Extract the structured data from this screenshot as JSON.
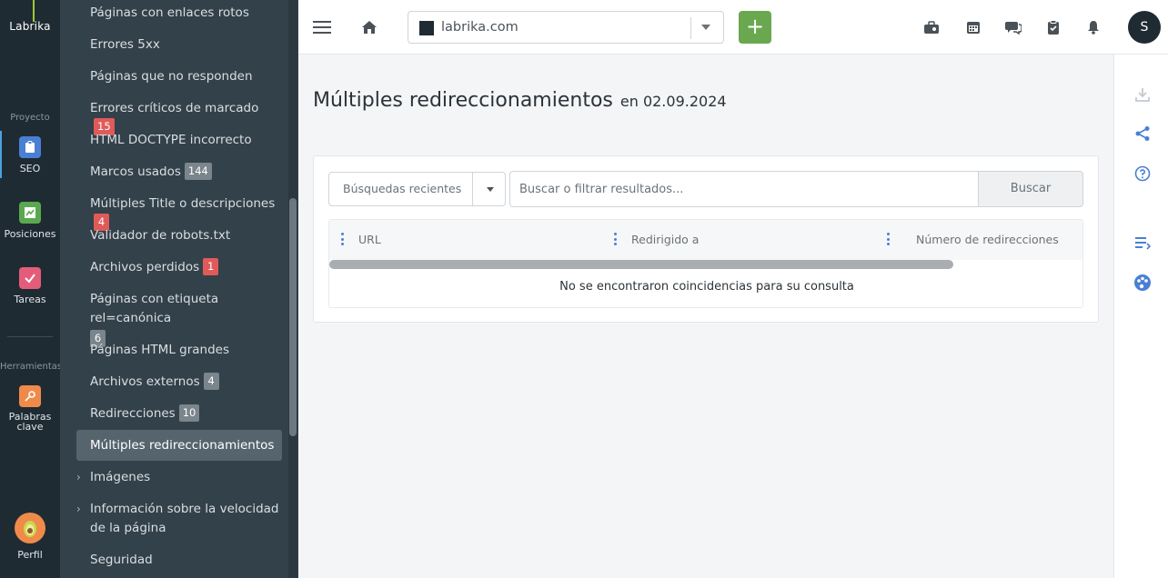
{
  "rail": {
    "logo": "Labrika",
    "section_project": "Proyecto",
    "section_tools": "Herramientas",
    "items": [
      {
        "label": "SEO",
        "icon": "clipboard-icon",
        "color": "#4a7fd4"
      },
      {
        "label": "Posiciones",
        "icon": "chart-icon",
        "color": "#5aa84f"
      },
      {
        "label": "Tareas",
        "icon": "check-icon",
        "color": "#e35d7a"
      },
      {
        "label": "Palabras clave",
        "icon": "key-icon",
        "color": "#f08a4b"
      },
      {
        "label": "Perfil",
        "icon": "avocado-avatar-icon",
        "color": "#f08a4b"
      }
    ]
  },
  "subnav": {
    "items": [
      {
        "label": "Páginas con enlaces rotos"
      },
      {
        "label": "Errores 5xx"
      },
      {
        "label": "Páginas que no responden"
      },
      {
        "label": "Errores críticos de marcado",
        "badge": "15",
        "badge_color": "red"
      },
      {
        "label": "HTML DOCTYPE incorrecto"
      },
      {
        "label": "Marcos usados",
        "badge": "144",
        "badge_color": "gray"
      },
      {
        "label": "Múltiples Title o descripciones",
        "badge": "4",
        "badge_color": "red"
      },
      {
        "label": "Validador de robots.txt"
      },
      {
        "label": "Archivos perdidos",
        "badge": "1",
        "badge_color": "red"
      },
      {
        "label": "Páginas con etiqueta rel=canónica",
        "badge": "6",
        "badge_color": "gray"
      },
      {
        "label": "Páginas HTML grandes"
      },
      {
        "label": "Archivos externos",
        "badge": "4",
        "badge_color": "gray"
      },
      {
        "label": "Redirecciones",
        "badge": "10",
        "badge_color": "gray"
      },
      {
        "label": "Múltiples redireccionamientos",
        "active": true
      },
      {
        "label": "Imágenes",
        "expandable": true
      },
      {
        "label": "Información sobre la velocidad de la página",
        "expandable": true
      },
      {
        "label": "Seguridad"
      }
    ]
  },
  "header": {
    "site": "labrika.com",
    "add_label": "+",
    "user_initial": "S",
    "icons": [
      "menu-icon",
      "home-icon",
      "briefcase-icon",
      "calendar-icon",
      "chat-icon",
      "clipboard-check-icon",
      "bell-icon"
    ]
  },
  "main": {
    "title": "Múltiples redireccionamientos",
    "date": "en 02.09.2024",
    "recent_searches": "Búsquedas recientes",
    "search_placeholder": "Buscar o filtrar resultados...",
    "search_button": "Buscar",
    "columns": [
      "URL",
      "Redirigido a",
      "Número de redirecciones"
    ],
    "empty_message": "No se encontraron coincidencias para su consulta"
  },
  "tools": {
    "icons": [
      "download-icon",
      "share-icon",
      "help-icon",
      "list-icon",
      "palette-icon"
    ]
  }
}
